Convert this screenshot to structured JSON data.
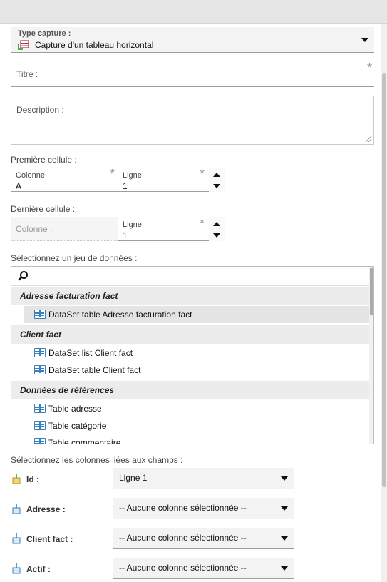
{
  "type_capture": {
    "label": "Type capture :",
    "value": "Capture d'un tableau horizontal",
    "icon": "table-capture-icon"
  },
  "titre": {
    "label": "Titre :",
    "required_mark": "*"
  },
  "description": {
    "label": "Description :"
  },
  "premiere_cellule": {
    "title": "Première cellule :",
    "colonne": {
      "label": "Colonne :",
      "value": "A",
      "required_mark": "*"
    },
    "ligne": {
      "label": "Ligne :",
      "value": "1",
      "required_mark": "*"
    }
  },
  "derniere_cellule": {
    "title": "Dernière cellule :",
    "colonne": {
      "label": "Colonne :"
    },
    "ligne": {
      "label": "Ligne :",
      "value": "1",
      "required_mark": "*"
    }
  },
  "dataset": {
    "title": "Sélectionnez un jeu de données :",
    "required_mark": "*",
    "groups": [
      {
        "name": "Adresse facturation fact",
        "items": [
          "DataSet table Adresse facturation fact"
        ]
      },
      {
        "name": "Client fact",
        "items": [
          "DataSet list Client fact",
          "DataSet table Client fact"
        ]
      },
      {
        "name": "Données de références",
        "items": [
          "Table adresse",
          "Table catégorie",
          "Table commentaire"
        ]
      }
    ]
  },
  "mapping": {
    "title": "Sélectionnez les colonnes liées aux champs :",
    "rows": [
      {
        "label": "Id :",
        "value": "Ligne 1"
      },
      {
        "label": "Adresse :",
        "value": "-- Aucune colonne sélectionnée --"
      },
      {
        "label": "Client fact :",
        "value": "-- Aucune colonne sélectionnée --"
      },
      {
        "label": "Actif :",
        "value": "-- Aucune colonne sélectionnée --"
      }
    ]
  },
  "colors": {
    "accent": "#3a7fbd",
    "selected_row": "#e4e4e4",
    "group_bg": "#ececec"
  }
}
